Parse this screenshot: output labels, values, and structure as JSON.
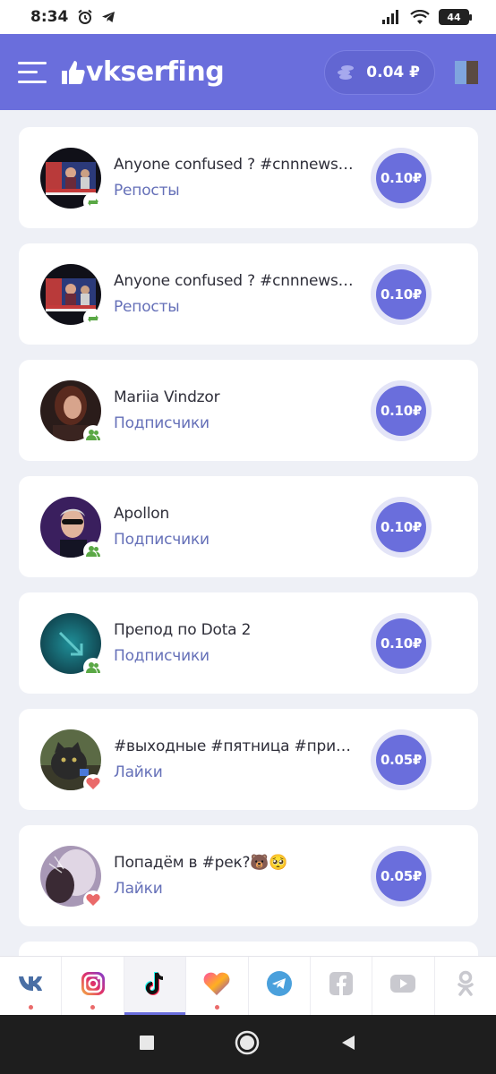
{
  "status_bar": {
    "time": "8:34",
    "battery": "44"
  },
  "header": {
    "logo": "vkserfing",
    "balance": "0.04 ₽"
  },
  "tasks": [
    {
      "title": "Anyone confused ? #cnnnews #tr",
      "type": "Репосты",
      "price": "0.10₽",
      "badge": "repost-icon",
      "thumb": "news"
    },
    {
      "title": "Anyone confused ? #cnnnews #tr",
      "type": "Репосты",
      "price": "0.10₽",
      "badge": "repost-icon",
      "thumb": "news"
    },
    {
      "title": "Mariia Vindzor",
      "type": "Подписчики",
      "price": "0.10₽",
      "badge": "followers-icon",
      "thumb": "woman"
    },
    {
      "title": "Apollon",
      "type": "Подписчики",
      "price": "0.10₽",
      "badge": "followers-icon",
      "thumb": "man"
    },
    {
      "title": "Препод по Dota 2",
      "type": "Подписчики",
      "price": "0.10₽",
      "badge": "followers-icon",
      "thumb": "teal"
    },
    {
      "title": "#выходные #пятница #приколы",
      "type": "Лайки",
      "price": "0.05₽",
      "badge": "heart-icon",
      "thumb": "cat"
    },
    {
      "title": "Попадём в #рек?🐻🥺",
      "type": "Лайки",
      "price": "0.05₽",
      "badge": "heart-icon",
      "thumb": "purple"
    }
  ],
  "networks": [
    {
      "name": "vk-icon",
      "dot": true,
      "active": false
    },
    {
      "name": "instagram-icon",
      "dot": true,
      "active": false
    },
    {
      "name": "tiktok-icon",
      "dot": false,
      "active": true
    },
    {
      "name": "likee-icon",
      "dot": true,
      "active": false
    },
    {
      "name": "telegram-icon",
      "dot": false,
      "active": false
    },
    {
      "name": "facebook-icon",
      "dot": false,
      "active": false
    },
    {
      "name": "youtube-icon",
      "dot": false,
      "active": false
    },
    {
      "name": "odnoklassniki-icon",
      "dot": false,
      "active": false
    }
  ],
  "colors": {
    "accent": "#6a6edc",
    "type_text": "#6570b8",
    "price_ring": "#e3e4f7",
    "heart": "#ea6a6a",
    "badge_green": "#5aa845"
  }
}
